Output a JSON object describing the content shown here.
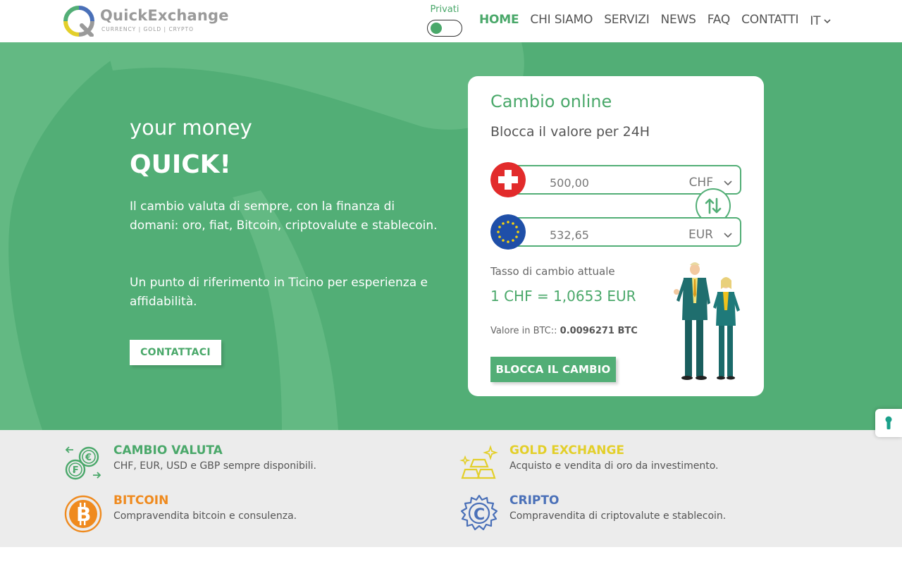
{
  "brand": {
    "name": "QuickExchange",
    "tagline": "CURRENCY | GOLD | CRYPTO"
  },
  "header": {
    "toggle_label": "Privati",
    "nav": [
      {
        "label": "HOME",
        "active": true
      },
      {
        "label": "CHI SIAMO",
        "active": false
      },
      {
        "label": "SERVIZI",
        "active": false
      },
      {
        "label": "NEWS",
        "active": false
      },
      {
        "label": "FAQ",
        "active": false
      },
      {
        "label": "CONTATTI",
        "active": false
      }
    ],
    "language": "IT"
  },
  "hero": {
    "subtitle": "your money",
    "title": "QUICK!",
    "paragraph1": "Il cambio valuta di sempre, con la finanza di domani: oro, fiat, Bitcoin, criptovalute e stablecoin.",
    "paragraph2": "Un punto di riferimento in Ticino per esperienza e affidabilità.",
    "contact_button": "CONTATTACI"
  },
  "converter": {
    "title": "Cambio online",
    "subtitle": "Blocca il valore per 24H",
    "from": {
      "amount": "500,00",
      "currency": "CHF",
      "flag": "swiss-flag"
    },
    "to": {
      "amount": "532,65",
      "currency": "EUR",
      "flag": "eu-flag"
    },
    "rate_label": "Tasso di cambio attuale",
    "rate_value": "1 CHF = 1,0653 EUR",
    "btc_label": "Valore in BTC:: ",
    "btc_value": "0.0096271 BTC",
    "lock_button": "BLOCCA IL CAMBIO"
  },
  "features": [
    {
      "title": "CAMBIO VALUTA",
      "desc": "CHF, EUR, USD e GBP sempre disponibili.",
      "color": "#4aa86a",
      "icon": "currency-exchange-icon"
    },
    {
      "title": "GOLD EXCHANGE",
      "desc": "Acquisto e vendita di oro da investimento.",
      "color": "#e3cf2a",
      "icon": "gold-bars-icon"
    },
    {
      "title": "BITCOIN",
      "desc": "Compravendita bitcoin e consulenza.",
      "color": "#ef8a1e",
      "icon": "bitcoin-icon"
    },
    {
      "title": "CRIPTO",
      "desc": "Compravendita di criptovalute e stablecoin.",
      "color": "#4a70b8",
      "icon": "crypto-gear-icon"
    }
  ],
  "colors": {
    "primary": "#52ae76",
    "accent_text": "#4aa86a",
    "gold": "#e3cf2a",
    "bitcoin": "#ef8a1e",
    "crypto": "#4a70b8"
  }
}
